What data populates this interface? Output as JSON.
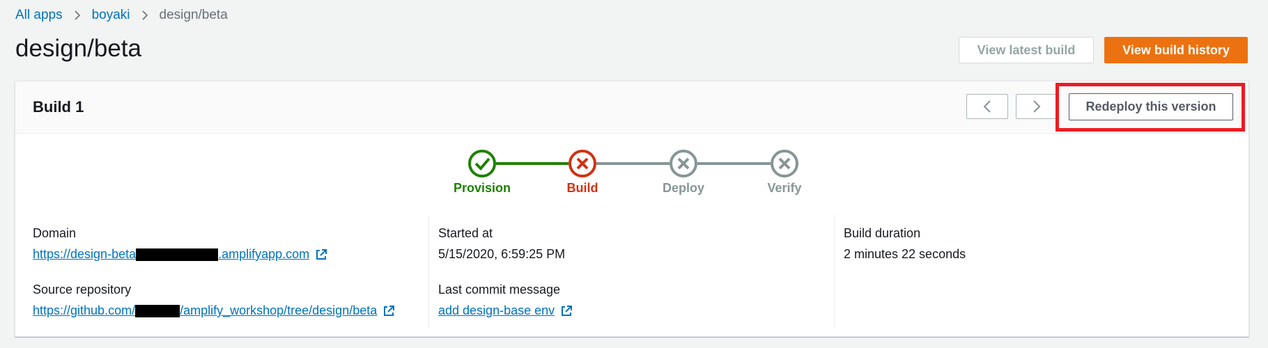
{
  "breadcrumb": {
    "items": [
      "All apps",
      "boyaki"
    ],
    "current": "design/beta"
  },
  "page": {
    "title": "design/beta"
  },
  "actions": {
    "view_latest": "View latest build",
    "view_history": "View build history"
  },
  "build": {
    "title": "Build 1",
    "redeploy_label": "Redeploy this version",
    "steps": [
      {
        "label": "Provision",
        "status": "success",
        "color": "#1d8102"
      },
      {
        "label": "Build",
        "status": "failed",
        "color": "#d13212"
      },
      {
        "label": "Deploy",
        "status": "not-run",
        "color": "#879596"
      },
      {
        "label": "Verify",
        "status": "not-run",
        "color": "#879596"
      }
    ],
    "domain": {
      "label": "Domain",
      "prefix": "https://design-beta",
      "suffix": ".amplifyapp.com"
    },
    "source": {
      "label": "Source repository",
      "prefix": "https://github.com/",
      "suffix": "/amplify_workshop/tree/design/beta"
    },
    "started": {
      "label": "Started at",
      "value": "5/15/2020, 6:59:25 PM"
    },
    "commit": {
      "label": "Last commit message",
      "value": "add design-base env"
    },
    "duration": {
      "label": "Build duration",
      "value": "2 minutes 22 seconds"
    }
  },
  "colors": {
    "accent": "#ec7211",
    "link": "#0073bb",
    "highlight": "#ec1c24"
  }
}
